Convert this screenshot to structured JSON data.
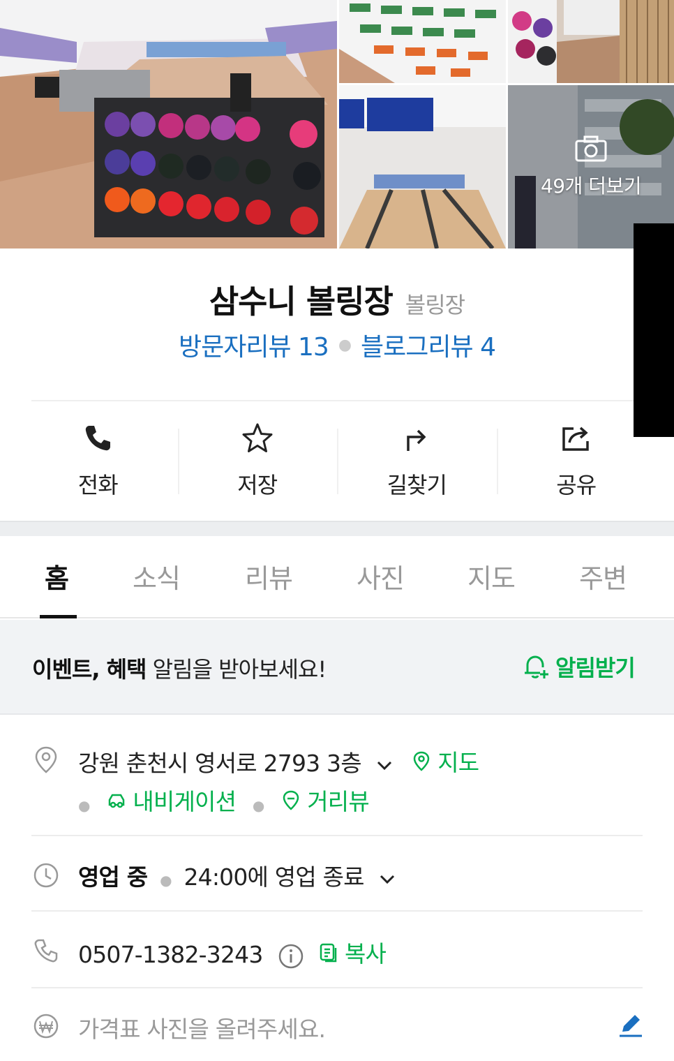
{
  "gallery": {
    "more_label": "49개 더보기"
  },
  "place": {
    "name": "삼수니 볼링장",
    "category": "볼링장",
    "visitor_review": "방문자리뷰 13",
    "blog_review": "블로그리뷰 4"
  },
  "actions": [
    {
      "label": "전화",
      "icon": "phone-icon"
    },
    {
      "label": "저장",
      "icon": "star-icon"
    },
    {
      "label": "길찾기",
      "icon": "directions-icon"
    },
    {
      "label": "공유",
      "icon": "share-icon"
    }
  ],
  "tabs": [
    "홈",
    "소식",
    "리뷰",
    "사진",
    "지도",
    "주변"
  ],
  "notify": {
    "bold1": "이벤트, 혜택",
    "rest": " 알림을 받아보세요!",
    "button": "알림받기"
  },
  "address": {
    "text": "강원 춘천시 영서로 2793 3층",
    "map": "지도",
    "navigation": "내비게이션",
    "streetview": "거리뷰"
  },
  "hours": {
    "status": "영업 중",
    "detail": "24:00에 영업 종료"
  },
  "phone": {
    "number": "0507-1382-3243",
    "copy": "복사"
  },
  "price": {
    "placeholder": "가격표 사진을 올려주세요."
  },
  "colors": {
    "green": "#03b04d",
    "link_blue": "#1a6fc0"
  }
}
